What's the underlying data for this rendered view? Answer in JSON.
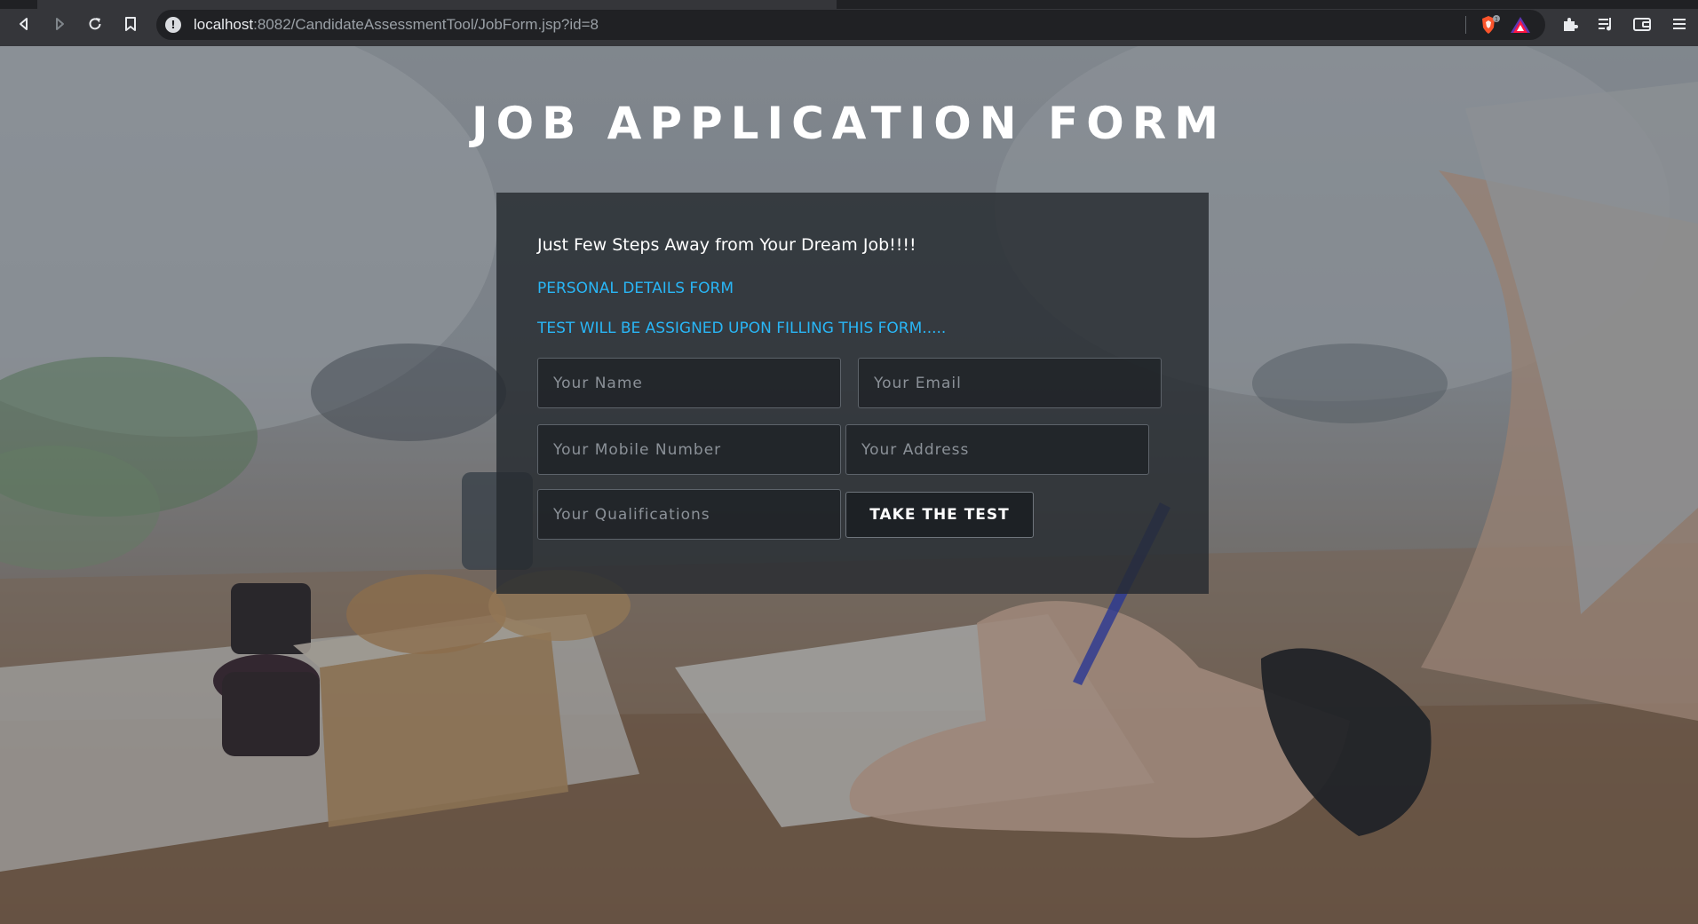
{
  "browser": {
    "url_host": "localhost",
    "url_rest": ":8082/CandidateAssessmentTool/JobForm.jsp?id=8",
    "brave_badge": "1",
    "icons": [
      "back-icon",
      "forward-icon",
      "reload-icon",
      "bookmark-icon",
      "site-info-icon",
      "brave-shields-icon",
      "brave-rewards-icon",
      "extensions-icon",
      "playlist-icon",
      "wallet-icon",
      "menu-icon"
    ]
  },
  "page": {
    "title": "JOB APPLICATION FORM",
    "tagline": "Just Few Steps Away from Your Dream Job!!!!",
    "section_heading": "PERSONAL DETAILS FORM",
    "notice": "TEST WILL BE ASSIGNED UPON FILLING THIS FORM.....",
    "accent_color": "#29b6f6"
  },
  "form": {
    "name_placeholder": "Your Name",
    "email_placeholder": "Your Email",
    "mobile_placeholder": "Your Mobile Number",
    "address_placeholder": "Your Address",
    "qualifications_placeholder": "Your Qualifications",
    "submit_label": "TAKE THE TEST"
  }
}
